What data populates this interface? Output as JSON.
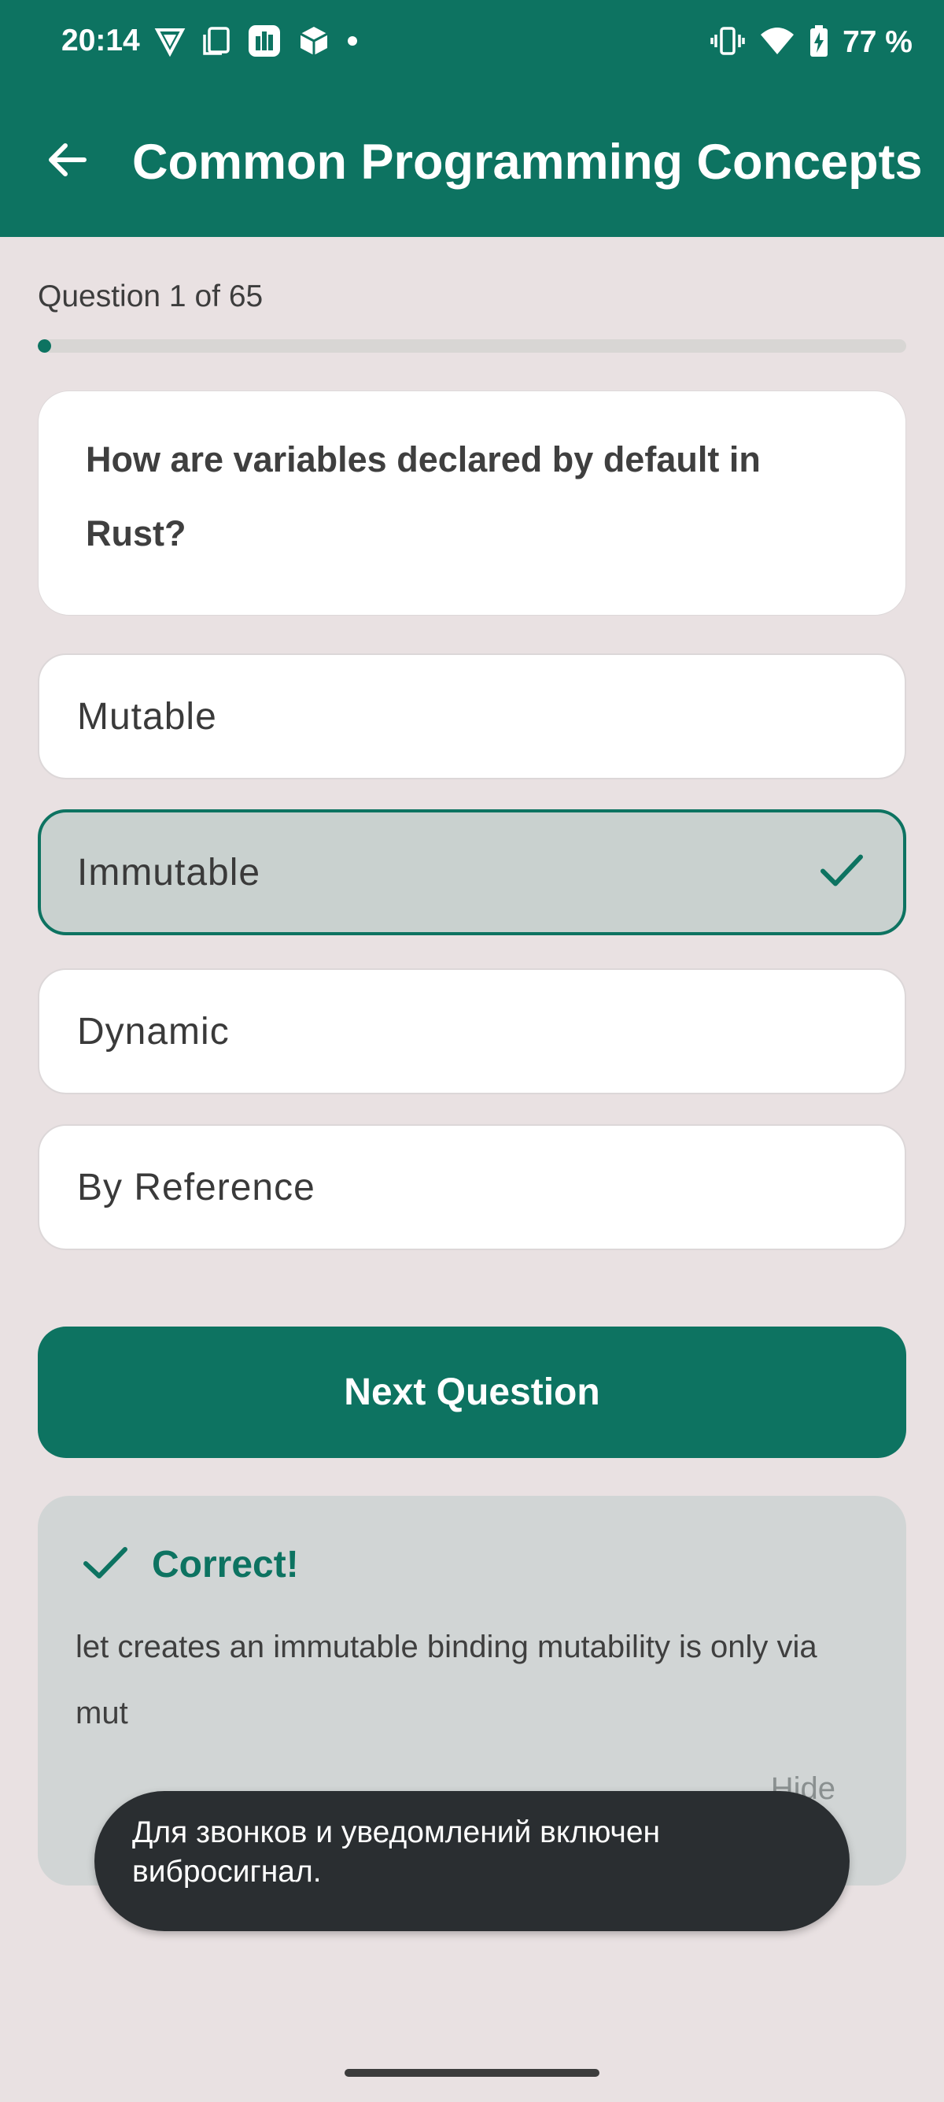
{
  "status_bar": {
    "time": "20:14",
    "left_icons": [
      "vpn-icon",
      "copy-icon",
      "app-icon",
      "box-icon",
      "dot-icon"
    ],
    "right_icons": [
      "vibrate-icon",
      "wifi-icon",
      "battery-charging-icon"
    ],
    "battery": "77 %"
  },
  "app_bar": {
    "title": "Common Programming Concepts",
    "back_icon": "arrow-left-icon"
  },
  "quiz": {
    "counter": "Question 1 of 65",
    "progress_fraction": 0.015,
    "question": "How are variables declared by default in Rust?",
    "options": [
      {
        "label": "Mutable",
        "selected": false
      },
      {
        "label": "Immutable",
        "selected": true
      },
      {
        "label": "Dynamic",
        "selected": false
      },
      {
        "label": "By Reference",
        "selected": false
      }
    ],
    "next_button": "Next Question"
  },
  "feedback": {
    "icon": "check-icon",
    "title": "Correct!",
    "text": "let creates an immutable binding mutability is only via mut",
    "hide_label": "Hide"
  },
  "toast": {
    "text": "Для звонков и уведомлений включен вибросигнал."
  },
  "colors": {
    "primary": "#0d7361",
    "background": "#e9e1e2",
    "selected_option": "#c9d1cf",
    "feedback_bg": "#d1d5d5",
    "toast_bg": "#2a2e31"
  }
}
